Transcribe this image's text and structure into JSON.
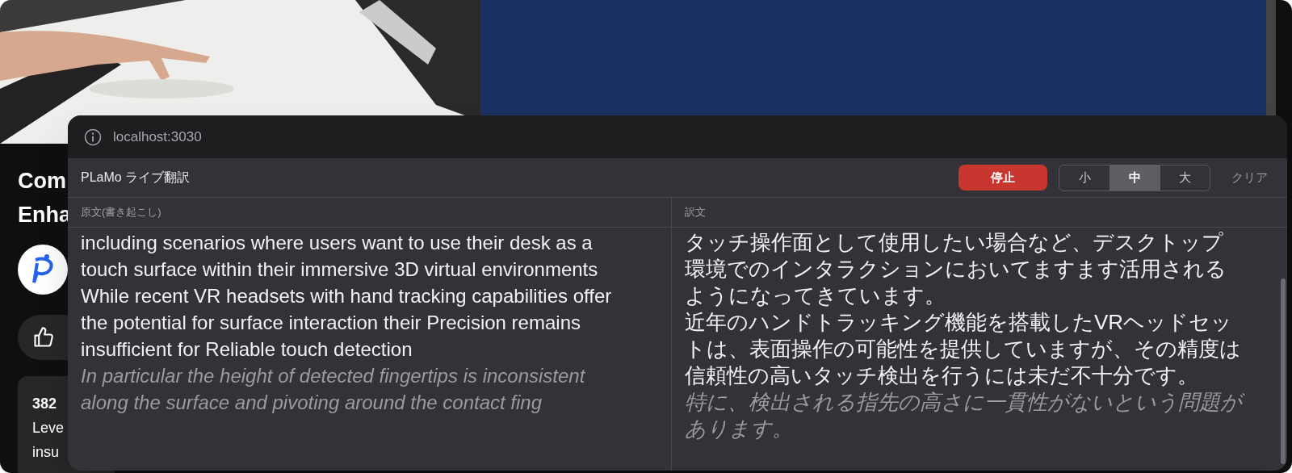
{
  "page": {
    "title_lines": [
      "Com",
      "Enha"
    ],
    "comment_lines": [
      "382",
      "Leve",
      "insu"
    ]
  },
  "popup": {
    "address": "localhost:3030",
    "title": "PLaMo ライブ翻訳",
    "stop_button": "停止",
    "sizes": [
      {
        "label": "小",
        "selected": false
      },
      {
        "label": "中",
        "selected": true
      },
      {
        "label": "大",
        "selected": false
      }
    ],
    "clear_button": "クリア",
    "source": {
      "heading": "原文(書き起こし)",
      "paragraphs": [
        {
          "text": "including scenarios where users want to use their desk as a touch surface within their immersive 3D virtual environments",
          "final": true
        },
        {
          "text": "While recent VR headsets with hand tracking capabilities offer the potential for surface interaction their Precision remains insufficient for Reliable touch detection",
          "final": true
        },
        {
          "text": "In particular the height of detected fingertips is inconsistent along the surface and pivoting around the contact fing",
          "final": false
        }
      ]
    },
    "translation": {
      "heading": "訳文",
      "paragraphs": [
        {
          "text": "タッチ操作面として使用したい場合など、デスクトップ環境でのインタラクションにおいてますます活用されるようになってきています。",
          "final": true
        },
        {
          "text": "近年のハンドトラッキング機能を搭載したVRヘッドセットは、表面操作の可能性を提供していますが、その精度は信頼性の高いタッチ検出を行うには未だ不十分です。",
          "final": true
        },
        {
          "text": "特に、検出される指先の高さに一貫性がないという問題があります。",
          "final": false
        }
      ]
    }
  }
}
